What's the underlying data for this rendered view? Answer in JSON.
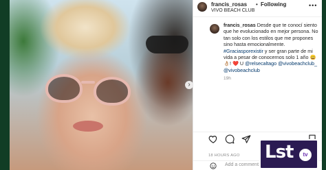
{
  "post": {
    "username": "francis_rosas",
    "separator": "•",
    "follow_label": "Following",
    "location": "VIVO BEACH CLUB",
    "more_label": "•••"
  },
  "comment": {
    "username": "francis_rosas",
    "caption_parts": [
      "Desde que te conocí siento que he evolucionado en mejor persona. No tan solo con los estilos que me propones sino hasta emocionalmente. ",
      "#Graciasporexistir",
      " y ser gran parte de mi vida a pesar de conocernos solo 1 año 😄👌🏼! ❤️ U ",
      "@relsecaltago",
      " ",
      "@vivobeachclub_",
      " ",
      "@vivobeachclub"
    ],
    "time": "19h"
  },
  "actions": {
    "like_icon": "heart-icon",
    "comment_icon": "comment-icon",
    "share_icon": "share-icon",
    "save_icon": "bookmark-icon",
    "date": "18 HOURS AGO"
  },
  "add_comment": {
    "emoji_icon": "smile-icon",
    "placeholder": "Add a comment..."
  },
  "photo": {
    "next_icon": "chevron-right-icon"
  },
  "watermark": {
    "text": "Lst",
    "badge": "tv"
  },
  "colors": {
    "background": "#0f3a22",
    "link": "#00376b",
    "muted": "#8e8e8e",
    "logo_bg": "#2b1b52"
  }
}
